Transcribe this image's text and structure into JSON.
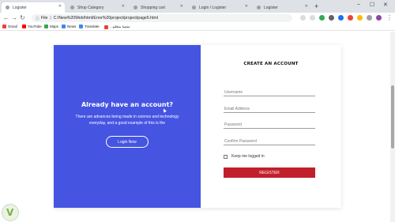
{
  "browser": {
    "tabs": [
      {
        "label": "Logister",
        "active": true
      },
      {
        "label": "Shop Category",
        "active": false
      },
      {
        "label": "Shopping cart",
        "active": false
      },
      {
        "label": "Login / Logister",
        "active": false
      },
      {
        "label": "Logister",
        "active": false
      }
    ],
    "new_tab_symbol": "+",
    "window_controls": {
      "minimize": "–",
      "maximize": "☐",
      "close": "✕"
    },
    "toolbar": {
      "back": "←",
      "forward": "→",
      "reload": "↻"
    },
    "address": {
      "scheme": "File",
      "url": "C:/New%20Web/html/Error%20project/project/page5.html"
    },
    "bookmarks": [
      {
        "label": "Gmail",
        "icon": "gmail-icon",
        "color": "#ea4335"
      },
      {
        "label": "YouTube",
        "icon": "youtube-icon",
        "color": "#ff0000"
      },
      {
        "label": "Maps",
        "icon": "maps-icon",
        "color": "#34a853"
      },
      {
        "label": "News",
        "icon": "news-icon",
        "color": "#4285f4"
      },
      {
        "label": "Translate",
        "icon": "translate-icon",
        "color": "#4285f4"
      },
      {
        "label": "...منصة متعلم",
        "icon": "bookmark-icon",
        "color": "#ea4335"
      }
    ]
  },
  "overlay": {
    "heading": "Already have an account?",
    "description": "There are advances being made in science and technology everyday, and a good example of this is the",
    "login_button": "Login Now",
    "color": "#4654e2"
  },
  "form": {
    "title": "CREATE AN ACCOUNT",
    "username_placeholder": "Username",
    "email_placeholder": "Email Address",
    "password_placeholder": "Password",
    "confirm_placeholder": "Confirm Password",
    "remember_label": "Keep me logged in",
    "register_button": "REGISTER",
    "register_color": "#c21f2c"
  }
}
